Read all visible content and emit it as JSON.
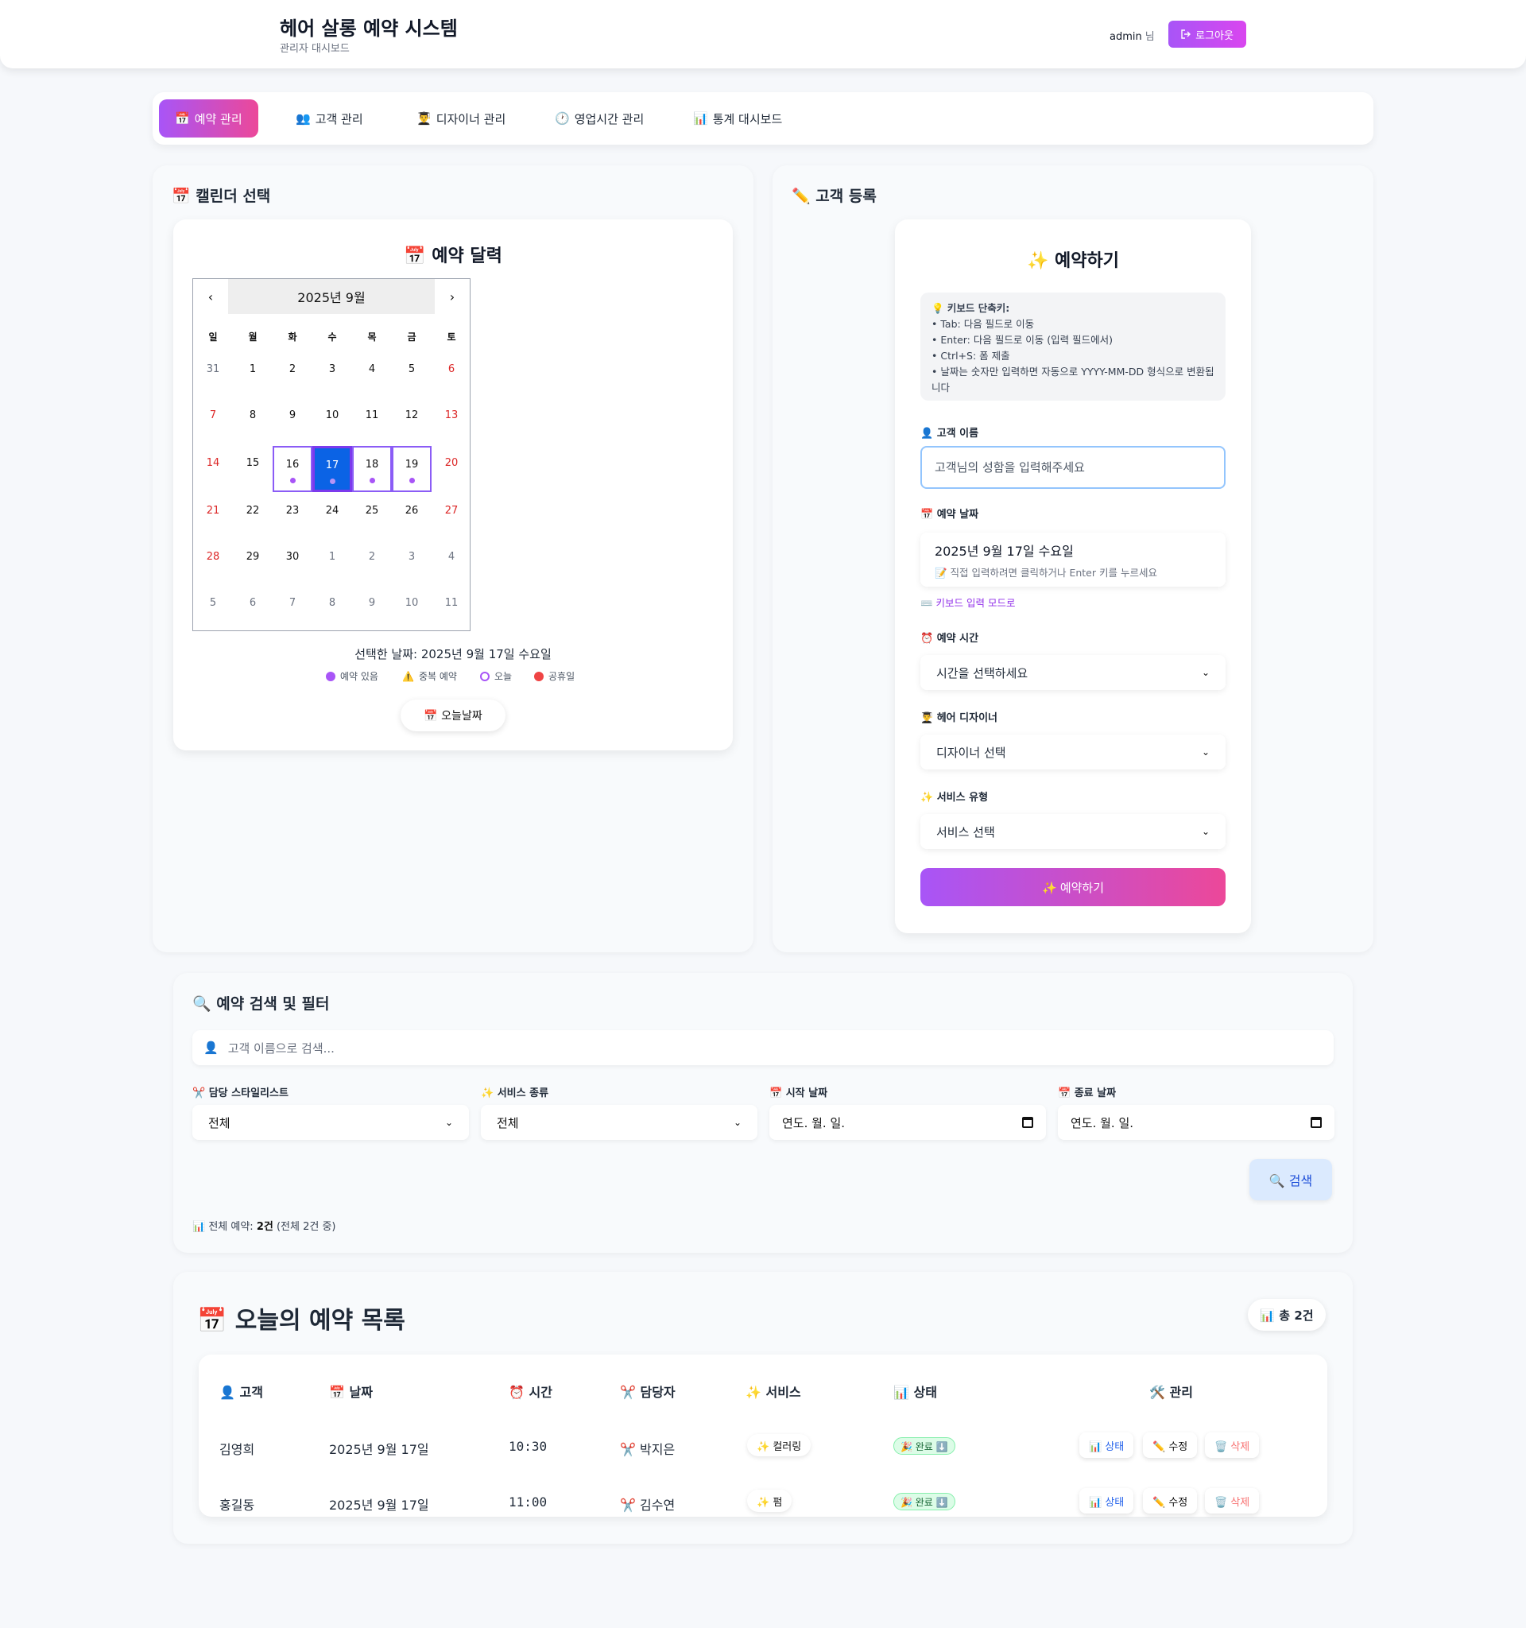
{
  "header": {
    "title": "헤어 살롱 예약 시스템",
    "subtitle": "관리자 대시보드",
    "username": "admin",
    "user_suffix": "님",
    "logout_label": "로그아웃",
    "accent": "#a855f7"
  },
  "nav": {
    "tabs": [
      {
        "icon": "📅",
        "label": "예약 관리"
      },
      {
        "icon": "👥",
        "label": "고객 관리"
      },
      {
        "icon": "👨‍🎓",
        "label": "디자이너 관리"
      },
      {
        "icon": "🕐",
        "label": "영업시간 관리"
      },
      {
        "icon": "📊",
        "label": "통계 대시보드"
      }
    ]
  },
  "calendar_panel": {
    "title": "📅 캘린더 선택",
    "card_title": "📅 예약 달력",
    "prev": "‹",
    "next": "›",
    "month_label": "2025년 9월",
    "weekdays": [
      "일",
      "월",
      "화",
      "수",
      "목",
      "금",
      "토"
    ],
    "weeks": [
      [
        "31",
        "1",
        "2",
        "3",
        "4",
        "5",
        "6"
      ],
      [
        "7",
        "8",
        "9",
        "10",
        "11",
        "12",
        "13"
      ],
      [
        "14",
        "15",
        "16",
        "17",
        "18",
        "19",
        "20"
      ],
      [
        "21",
        "22",
        "23",
        "24",
        "25",
        "26",
        "27"
      ],
      [
        "28",
        "29",
        "30",
        "1",
        "2",
        "3",
        "4"
      ],
      [
        "5",
        "6",
        "7",
        "8",
        "9",
        "10",
        "11"
      ]
    ],
    "selected_text": "선택한 날짜: 2025년 9월 17일 수요일",
    "legend": {
      "booked": "예약 있음",
      "duplicate_icon": "⚠️",
      "duplicate": "중복 예약",
      "today": "오늘",
      "holiday": "공휴일"
    },
    "today_button": "📅 오늘날짜"
  },
  "form_panel": {
    "title": "✏️ 고객 등록",
    "card_title": "✨ 예약하기",
    "hint_title": "💡 키보드 단축키:",
    "hints": [
      "• Tab: 다음 필드로 이동",
      "• Enter: 다음 필드로 이동 (입력 필드에서)",
      "• Ctrl+S: 폼 제출",
      "• 날짜는 숫자만 입력하면 자동으로 YYYY-MM-DD 형식으로 변환됩니다"
    ],
    "name_label": "👤 고객 이름",
    "name_placeholder": "고객님의 성함을 입력해주세요",
    "date_label": "📅 예약 날짜",
    "date_value": "2025년 9월 17일 수요일",
    "date_hint": "📝 직접 입력하려면 클릭하거나 Enter 키를 누르세요",
    "keyboard_mode": "⌨️ 키보드 입력 모드로",
    "time_label": "⏰ 예약 시간",
    "time_value": "시간을 선택하세요",
    "designer_label": "👨‍🎓 헤어 디자이너",
    "designer_value": "디자이너 선택",
    "service_label": "✨ 서비스 유형",
    "service_value": "서비스 선택",
    "submit": "✨ 예약하기"
  },
  "search_panel": {
    "title": "🔍 예약 검색 및 필터",
    "search_icon": "👤",
    "search_placeholder": "고객 이름으로 검색...",
    "stylist_label": "✂️ 담당 스타일리스트",
    "stylist_value": "전체",
    "service_label": "✨ 서비스 종류",
    "service_value": "전체",
    "start_label": "📅 시작 날짜",
    "start_value": "연도. 월. 일.",
    "end_label": "📅 종료 날짜",
    "end_value": "연도. 월. 일.",
    "search_button": "🔍 검색",
    "summary_prefix": "📊 전체 예약: ",
    "summary_count": "2건",
    "summary_suffix": " (전체 2건 중)"
  },
  "list_panel": {
    "title": "📅 오늘의 예약 목록",
    "total": "📊 총 2건",
    "columns": [
      "👤 고객",
      "📅 날짜",
      "⏰ 시간",
      "✂️ 담당자",
      "✨ 서비스",
      "📊 상태",
      "🛠️ 관리"
    ],
    "rows": [
      {
        "customer": "김영희",
        "date": "2025년 9월 17일",
        "time": "10:30",
        "stylist": "✂️ 박지은",
        "service": "✨ 컬러링",
        "status": "🎉 완료 ⬇️"
      },
      {
        "customer": "홍길동",
        "date": "2025년 9월 17일",
        "time": "11:00",
        "stylist": "✂️ 김수연",
        "service": "✨ 펌",
        "status": "🎉 완료 ⬇️"
      }
    ],
    "actions": {
      "status": "📊 상태",
      "edit": "✏️ 수정",
      "delete": "🗑️ 삭제"
    }
  }
}
